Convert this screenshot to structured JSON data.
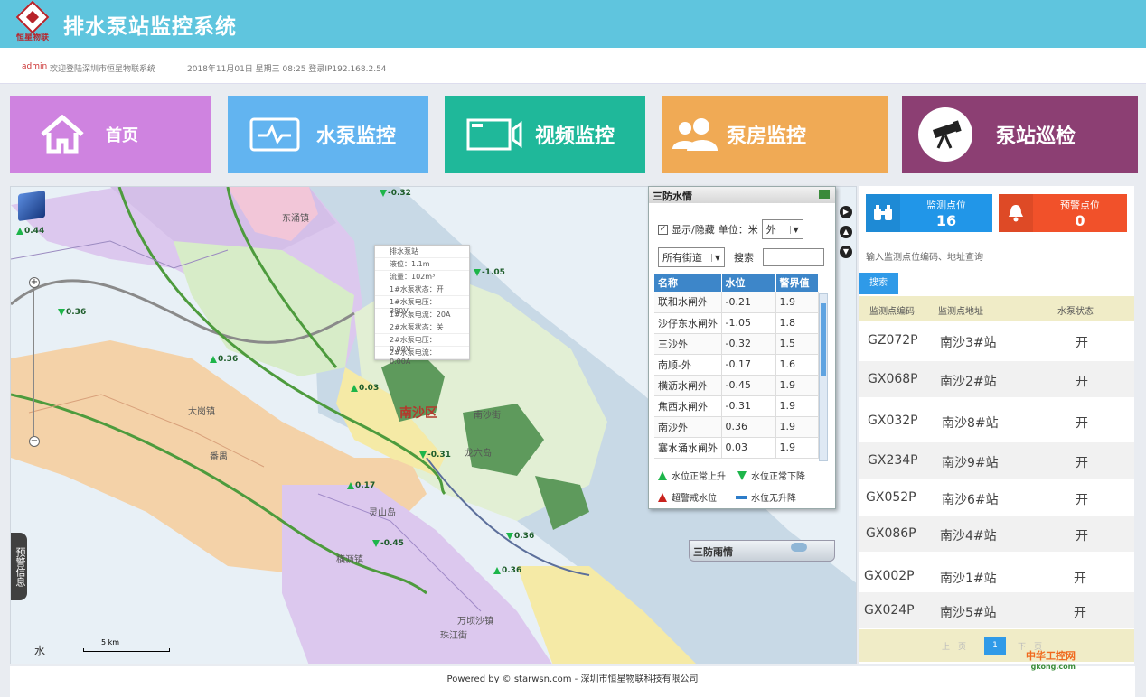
{
  "header": {
    "logo_text": "恒星物联",
    "title": "排水泵站监控系统"
  },
  "infobar": {
    "user": "admin",
    "welcome": "欢迎登陆深圳市恒星物联系统",
    "time_info": "2018年11月01日 星期三 08:25 登录IP192.168.2.54"
  },
  "nav": [
    {
      "label": "首页",
      "icon": "home-icon",
      "color": "#cf83e0"
    },
    {
      "label": "水泵监控",
      "icon": "pulse-monitor-icon",
      "color": "#62b4f0"
    },
    {
      "label": "视频监控",
      "icon": "video-camera-icon",
      "color": "#1fb89a"
    },
    {
      "label": "泵房监控",
      "icon": "users-icon",
      "color": "#f0aa55"
    },
    {
      "label": "泵站巡检",
      "icon": "telescope-icon",
      "color": "#8c3f73"
    }
  ],
  "map": {
    "district": "南沙区",
    "labels": [
      "东涌镇",
      "大岗镇",
      "横沥镇",
      "万顷沙镇",
      "珠江街",
      "南沙街",
      "龙穴岛",
      "灵山岛",
      "番禺"
    ],
    "alert_tab": "预警信息",
    "scale": "5 km",
    "water_char": "水",
    "sensors": [
      "-0.32",
      "0.44",
      "-1.05",
      "0.36",
      "0.36",
      "0.03",
      "-0.31",
      "0.17",
      "-0.45",
      "0.36",
      "0.36"
    ],
    "tooltip": {
      "title": "排水泵站",
      "lines": [
        "液位：1.1m",
        "流量：102m³",
        "1#水泵状态：开",
        "1#水泵电压：380V",
        "1#水泵电流：20A",
        "2#水泵状态：关",
        "2#水泵电压：0.00V",
        "2#水泵电流：0.00A"
      ]
    }
  },
  "water_panel": {
    "title": "三防水情",
    "show_hide": "显示/隐藏",
    "unit_label": "单位：米",
    "unit_value": "外",
    "street_select": "所有街道",
    "search_label": "搜索",
    "headers": [
      "名称",
      "水位",
      "警界值"
    ],
    "rows": [
      [
        "联和水闸外",
        "-0.21",
        "1.9"
      ],
      [
        "沙仔东水闸外",
        "-1.05",
        "1.8"
      ],
      [
        "三沙外",
        "-0.32",
        "1.5"
      ],
      [
        "南顺-外",
        "-0.17",
        "1.6"
      ],
      [
        "横沥水闸外",
        "-0.45",
        "1.9"
      ],
      [
        "焦西水闸外",
        "-0.31",
        "1.9"
      ],
      [
        "南沙外",
        "0.36",
        "1.9"
      ],
      [
        "塞水涌水闸外",
        "0.03",
        "1.9"
      ]
    ],
    "legend": {
      "rise": "水位正常上升",
      "fall": "水位正常下降",
      "over": "超警戒水位",
      "flat": "水位无升降"
    },
    "rain_title": "三防雨情"
  },
  "right_panel": {
    "monitor_label": "监测点位",
    "monitor_count": "16",
    "warning_label": "预警点位",
    "warning_count": "0",
    "search_placeholder": "输入监测点位编码、地址查询",
    "search_button": "搜索",
    "headers": [
      "监测点编码",
      "监测点地址",
      "水泵状态"
    ],
    "rows": [
      [
        "GZ072P",
        "南沙3#站",
        "开"
      ],
      [
        "GX068P",
        "南沙2#站",
        "开"
      ],
      [
        "GX032P",
        "南沙8#站",
        "开"
      ],
      [
        "GX234P",
        "南沙9#站",
        "开"
      ],
      [
        "GX052P",
        "南沙6#站",
        "开"
      ],
      [
        "GX086P",
        "南沙4#站",
        "开"
      ],
      [
        "GX002P",
        "南沙1#站",
        "开"
      ],
      [
        "GX024P",
        "南沙5#站",
        "开"
      ]
    ],
    "pager": {
      "prev": "上一页",
      "current": "1",
      "next": "下一页"
    }
  },
  "footer": "Powered by © starwsn.com - 深圳市恒星物联科技有限公司",
  "watermark": {
    "name": "中华工控网",
    "url": "gkong.com"
  }
}
